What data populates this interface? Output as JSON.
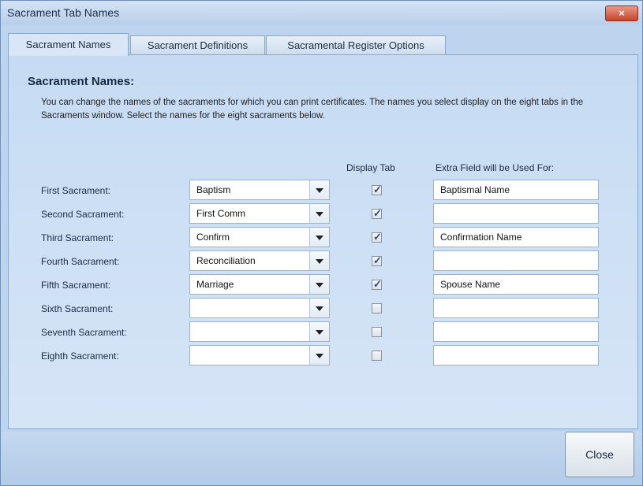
{
  "window": {
    "title": "Sacrament Tab Names",
    "close_glyph": "×"
  },
  "tabs": [
    {
      "label": "Sacrament Names",
      "active": true
    },
    {
      "label": "Sacrament Definitions",
      "active": false
    },
    {
      "label": "Sacramental Register Options",
      "active": false
    }
  ],
  "panel": {
    "heading": "Sacrament Names:",
    "description": "You can change the names of the sacraments for which you can print certificates. The names you select display on the eight tabs in the Sacraments window. Select the names for the eight sacraments below.",
    "col_display_tab": "Display Tab",
    "col_extra_field": "Extra Field will be Used For:"
  },
  "rows": [
    {
      "label": "First Sacrament:",
      "name": "Baptism",
      "display": true,
      "extra": "Baptismal Name"
    },
    {
      "label": "Second Sacrament:",
      "name": "First Comm",
      "display": true,
      "extra": ""
    },
    {
      "label": "Third Sacrament:",
      "name": "Confirm",
      "display": true,
      "extra": "Confirmation Name"
    },
    {
      "label": "Fourth Sacrament:",
      "name": "Reconciliation",
      "display": true,
      "extra": ""
    },
    {
      "label": "Fifth Sacrament:",
      "name": "Marriage",
      "display": true,
      "extra": "Spouse Name"
    },
    {
      "label": "Sixth Sacrament:",
      "name": "",
      "display": false,
      "extra": ""
    },
    {
      "label": "Seventh Sacrament:",
      "name": "",
      "display": false,
      "extra": ""
    },
    {
      "label": "Eighth Sacrament:",
      "name": "",
      "display": false,
      "extra": ""
    }
  ],
  "footer": {
    "close_label": "Close"
  },
  "icons": {
    "close": "close-icon",
    "dropdown": "chevron-down-icon",
    "checkbox": "checkbox-icon"
  },
  "colors": {
    "window_bg": "#bcd4ee",
    "close_button": "#c7452a",
    "accent_text": "#172a44"
  }
}
